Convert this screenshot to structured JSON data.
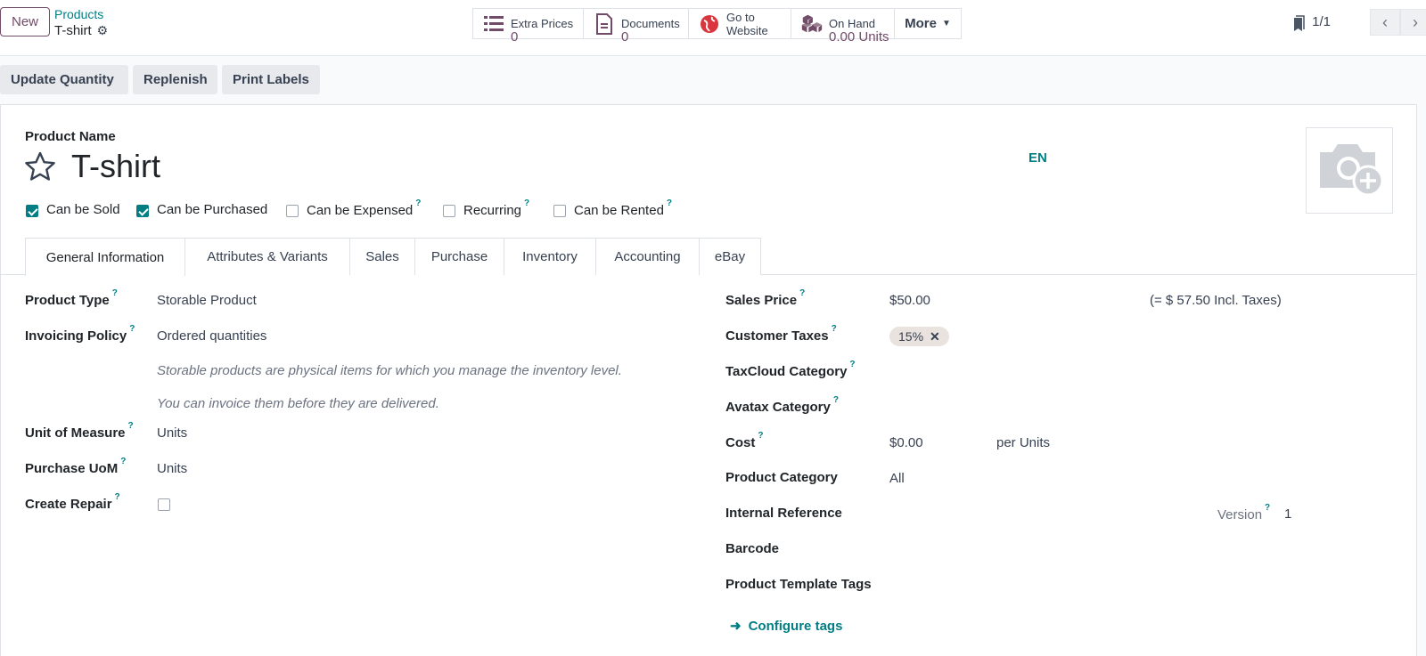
{
  "toolbar": {
    "new_label": "New",
    "breadcrumb_parent": "Products",
    "breadcrumb_current": "T-shirt"
  },
  "smart_buttons": {
    "extra_prices": {
      "label": "Extra Prices",
      "value": "0"
    },
    "documents": {
      "label": "Documents",
      "value": "0"
    },
    "website": {
      "line1": "Go to",
      "line2": "Website"
    },
    "on_hand": {
      "label": "On Hand",
      "value": "0.00 Units"
    },
    "more": "More"
  },
  "pager": {
    "value": "1/1"
  },
  "actions": {
    "update_quantity": "Update Quantity",
    "replenish": "Replenish",
    "print_labels": "Print Labels"
  },
  "form": {
    "product_name_label": "Product Name",
    "product_name": "T-shirt",
    "lang": "EN",
    "checkboxes": [
      {
        "label": "Can be Sold",
        "checked": true
      },
      {
        "label": "Can be Purchased",
        "checked": true
      },
      {
        "label": "Can be Expensed",
        "checked": false
      },
      {
        "label": "Recurring",
        "checked": false
      },
      {
        "label": "Can be Rented",
        "checked": false
      }
    ],
    "tabs": [
      "General Information",
      "Attributes & Variants",
      "Sales",
      "Purchase",
      "Inventory",
      "Accounting",
      "eBay"
    ],
    "left": {
      "product_type_label": "Product Type",
      "product_type": "Storable Product",
      "invoicing_policy_label": "Invoicing Policy",
      "invoicing_policy": "Ordered quantities",
      "help1": "Storable products are physical items for which you manage the inventory level.",
      "help2": "You can invoice them before they are delivered.",
      "uom_label": "Unit of Measure",
      "uom": "Units",
      "purchase_uom_label": "Purchase UoM",
      "purchase_uom": "Units",
      "create_repair_label": "Create Repair"
    },
    "right": {
      "sales_price_label": "Sales Price",
      "sales_price": "$50.00",
      "incl_taxes": "(= $ 57.50 Incl. Taxes)",
      "customer_taxes_label": "Customer Taxes",
      "tax_tag": "15%",
      "taxcloud_label": "TaxCloud Category",
      "avatax_label": "Avatax Category",
      "cost_label": "Cost",
      "cost": "$0.00",
      "per_units": "per Units",
      "category_label": "Product Category",
      "category": "All",
      "internal_ref_label": "Internal Reference",
      "version_label": "Version",
      "version": "1",
      "barcode_label": "Barcode",
      "tags_label": "Product Template Tags",
      "configure_tags": "Configure tags"
    }
  },
  "colors": {
    "brand": "#714b67",
    "accent": "#017e84"
  }
}
